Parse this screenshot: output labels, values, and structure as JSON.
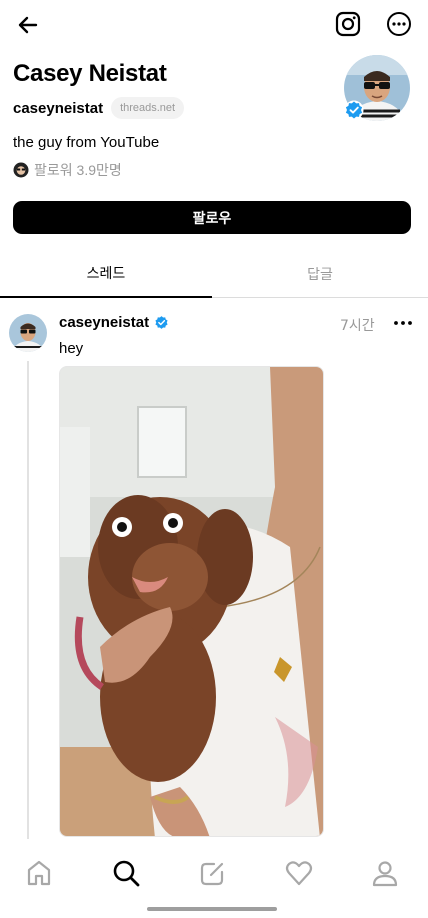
{
  "header": {
    "back_icon": "arrow-left-icon",
    "instagram_icon": "instagram-icon",
    "more_icon": "more-horizontal-icon"
  },
  "profile": {
    "name": "Casey Neistat",
    "handle": "caseyneistat",
    "domain_badge": "threads.net",
    "bio": "the guy from YouTube",
    "followers": "팔로워 3.9만명",
    "verified": true
  },
  "actions": {
    "follow_label": "팔로우"
  },
  "tabs": [
    {
      "label": "스레드",
      "active": true
    },
    {
      "label": "답글",
      "active": false
    }
  ],
  "post": {
    "author": "caseyneistat",
    "time": "7시간",
    "text": "hey",
    "image_icon": "photo-dog-icon"
  },
  "bottom_nav": [
    {
      "icon": "home-icon"
    },
    {
      "icon": "search-icon",
      "active": true
    },
    {
      "icon": "compose-icon"
    },
    {
      "icon": "heart-icon"
    },
    {
      "icon": "profile-icon"
    }
  ],
  "colors": {
    "verified_blue": "#1d9bf0",
    "muted_text": "#999999",
    "follow_button": "#000000"
  }
}
